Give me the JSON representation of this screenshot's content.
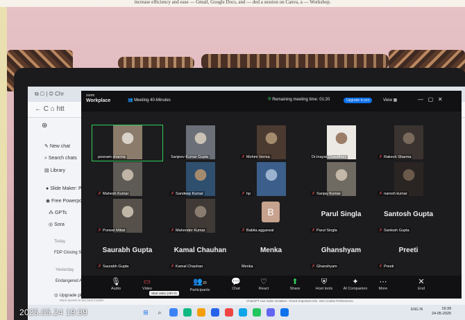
{
  "caption": "increase efficiency and ease — Gmail, Google Docs, and — ded a session on Canva, a — Workshop.",
  "zoom": {
    "brand_line1": "zoom",
    "brand_line2": "Workplace",
    "meeting_title": "Meeting 40-Minutes",
    "remaining_label": "Remaining meeting time: 01:20",
    "upgrade_label": "Upgrade to pro",
    "view_label": "View"
  },
  "sidebar": {
    "new_chat": "New chat",
    "search_chats": "Search chats",
    "library": "Library",
    "slide_maker": "Slide Maker: P",
    "free_powerpoint": "Free Powerpo",
    "gpts": "GPTs",
    "sora": "Sora",
    "today": "Today",
    "fdp": "FDP Closing Script",
    "yesterday": "Yesterday",
    "endangered": "Endangered Anim",
    "upgrade": "Upgrade plan",
    "upgrade_sub": "More access to the best models"
  },
  "participants": [
    {
      "name": "poonam sharma",
      "muted": false
    },
    {
      "name": "Sanjeev Kumar Gupta",
      "muted": false
    },
    {
      "name": "Mohini Verma",
      "muted": true
    },
    {
      "name": "Dr.Inayat Chaudhary",
      "muted": false
    },
    {
      "name": "Rakesh Sharma",
      "muted": true
    },
    {
      "name": "Mahesh Kumar",
      "muted": true
    },
    {
      "name": "Sandeep Kumar",
      "muted": true
    },
    {
      "name": "hp",
      "muted": true
    },
    {
      "name": "Sanjay Kumar",
      "muted": true
    },
    {
      "name": "naresh kumar",
      "muted": true
    },
    {
      "name": "Puneet Mittal",
      "muted": true
    },
    {
      "name": "Mahender Kumar",
      "muted": true
    },
    {
      "name": "Babita aggarwal",
      "muted": true,
      "avatar_letter": "B"
    },
    {
      "name": "Parul Singla",
      "muted": true
    },
    {
      "name": "Santosh Gupta",
      "muted": true
    },
    {
      "name": "Saurabh Gupta",
      "muted": true
    },
    {
      "name": "Kamal Chauhan",
      "muted": true
    },
    {
      "name": "Menka",
      "muted": false
    },
    {
      "name": "Ghanshyam",
      "muted": true
    },
    {
      "name": "Preeti",
      "muted": true
    }
  ],
  "toolbar": {
    "audio": "Audio",
    "video": "Video",
    "tooltip": "Start video (Alt+V)",
    "participants": "Participants",
    "participants_count": "20",
    "chat": "Chat",
    "react": "React",
    "share": "Share",
    "host_tools": "Host tools",
    "ai_companion": "AI Companion",
    "more": "More",
    "end": "End"
  },
  "chatgpt_footer": "ChatGPT can make mistakes. Check important info. See Cookie Preferences.",
  "taskbar": {
    "lang": "ENG IN",
    "time": "19:39",
    "date": "24-05-2025"
  },
  "timestamp": "2025.05.24 19:39",
  "colors": {
    "zoom_bg": "#1c1c1e",
    "upgrade_blue": "#0e72ed",
    "active_border": "#2fd15a",
    "muted_red": "#e34a4a"
  }
}
